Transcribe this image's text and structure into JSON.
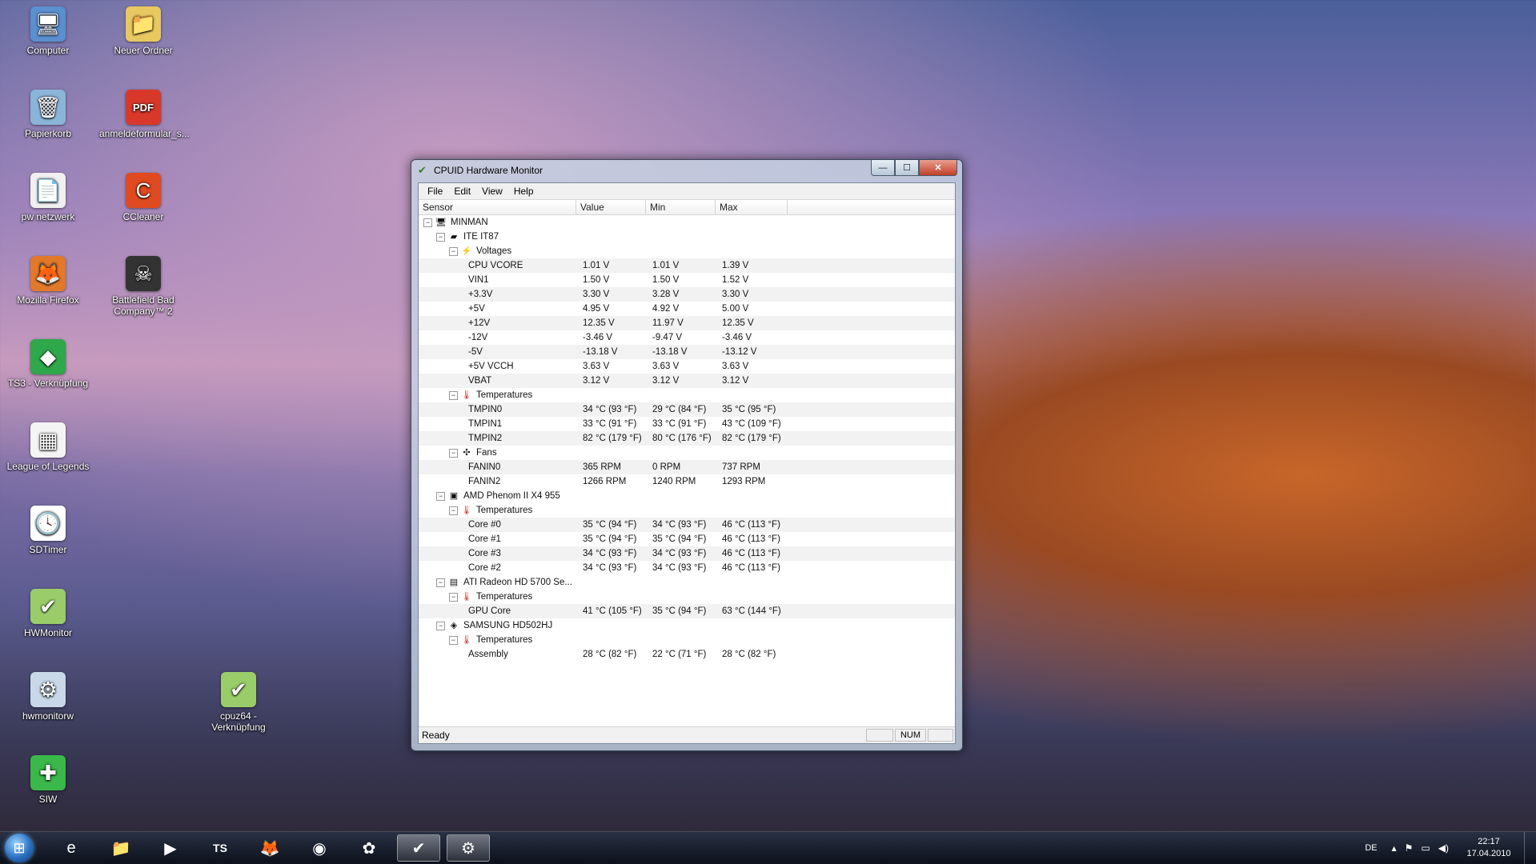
{
  "desktop_icons": [
    {
      "label": "Computer",
      "icon": "computer-icon",
      "glyph": "🖥",
      "bg": "#5a8fd0"
    },
    {
      "label": "Neuer Ordner",
      "icon": "folder-icon",
      "glyph": "📁",
      "bg": "#e8c860"
    },
    {
      "label": "Papierkorb",
      "icon": "recycle-bin-icon",
      "glyph": "🗑",
      "bg": "#8ab4d8"
    },
    {
      "label": "anmeldeformular_s...",
      "icon": "pdf-icon",
      "glyph": "PDF",
      "bg": "#d8382a"
    },
    {
      "label": "pw netzwerk",
      "icon": "text-file-icon",
      "glyph": "📄",
      "bg": "#f0f0f0"
    },
    {
      "label": "CCleaner",
      "icon": "ccleaner-icon",
      "glyph": "C",
      "bg": "#e04a20"
    },
    {
      "label": "Mozilla Firefox",
      "icon": "firefox-icon",
      "glyph": "🦊",
      "bg": "#e2782a"
    },
    {
      "label": "Battlefield Bad Company™ 2",
      "icon": "game-icon",
      "glyph": "☠",
      "bg": "#333333"
    },
    {
      "label": "TS3 - Verknüpfung",
      "icon": "sims-icon",
      "glyph": "◆",
      "bg": "#2ea84a"
    },
    {
      "label": "League of Legends",
      "icon": "calendar-icon",
      "glyph": "▦",
      "bg": "#f4f4f4"
    },
    {
      "label": "SDTimer",
      "icon": "clock-icon",
      "glyph": "🕓",
      "bg": "#ffffff"
    },
    {
      "label": "HWMonitor",
      "icon": "hwmonitor-icon",
      "glyph": "✔",
      "bg": "#9acd6a"
    },
    {
      "label": "hwmonitorw",
      "icon": "gear-icon",
      "glyph": "⚙",
      "bg": "#c8d8e8"
    },
    {
      "label": "cpuz64 - Verknüpfung",
      "icon": "cpuz-icon",
      "glyph": "✔",
      "bg": "#9acd6a"
    },
    {
      "label": "SIW",
      "icon": "siw-icon",
      "glyph": "✚",
      "bg": "#3ab84a"
    }
  ],
  "window": {
    "title": "CPUID Hardware Monitor",
    "buttons": {
      "minimize": "—",
      "maximize": "☐",
      "close": "✕"
    },
    "menu": [
      "File",
      "Edit",
      "View",
      "Help"
    ],
    "columns": [
      "Sensor",
      "Value",
      "Min",
      "Max"
    ],
    "rows": [
      {
        "level": 0,
        "exp": "−",
        "icon": "🖥",
        "name": "MINMAN",
        "value": "",
        "min": "",
        "max": ""
      },
      {
        "level": 1,
        "exp": "−",
        "icon": "▰",
        "name": "ITE IT87",
        "value": "",
        "min": "",
        "max": ""
      },
      {
        "level": 2,
        "exp": "−",
        "icon": "⚡",
        "name": "Voltages",
        "value": "",
        "min": "",
        "max": ""
      },
      {
        "level": 3,
        "exp": "",
        "icon": "",
        "name": "CPU VCORE",
        "value": "1.01 V",
        "min": "1.01 V",
        "max": "1.39 V"
      },
      {
        "level": 3,
        "exp": "",
        "icon": "",
        "name": "VIN1",
        "value": "1.50 V",
        "min": "1.50 V",
        "max": "1.52 V"
      },
      {
        "level": 3,
        "exp": "",
        "icon": "",
        "name": "+3.3V",
        "value": "3.30 V",
        "min": "3.28 V",
        "max": "3.30 V"
      },
      {
        "level": 3,
        "exp": "",
        "icon": "",
        "name": "+5V",
        "value": "4.95 V",
        "min": "4.92 V",
        "max": "5.00 V"
      },
      {
        "level": 3,
        "exp": "",
        "icon": "",
        "name": "+12V",
        "value": "12.35 V",
        "min": "11.97 V",
        "max": "12.35 V"
      },
      {
        "level": 3,
        "exp": "",
        "icon": "",
        "name": "-12V",
        "value": "-3.46 V",
        "min": "-9.47 V",
        "max": "-3.46 V"
      },
      {
        "level": 3,
        "exp": "",
        "icon": "",
        "name": "-5V",
        "value": "-13.18 V",
        "min": "-13.18 V",
        "max": "-13.12 V"
      },
      {
        "level": 3,
        "exp": "",
        "icon": "",
        "name": "+5V VCCH",
        "value": "3.63 V",
        "min": "3.63 V",
        "max": "3.63 V"
      },
      {
        "level": 3,
        "exp": "",
        "icon": "",
        "name": "VBAT",
        "value": "3.12 V",
        "min": "3.12 V",
        "max": "3.12 V"
      },
      {
        "level": 2,
        "exp": "−",
        "icon": "🌡",
        "name": "Temperatures",
        "value": "",
        "min": "",
        "max": ""
      },
      {
        "level": 3,
        "exp": "",
        "icon": "",
        "name": "TMPIN0",
        "value": "34 °C (93 °F)",
        "min": "29 °C (84 °F)",
        "max": "35 °C (95 °F)"
      },
      {
        "level": 3,
        "exp": "",
        "icon": "",
        "name": "TMPIN1",
        "value": "33 °C (91 °F)",
        "min": "33 °C (91 °F)",
        "max": "43 °C (109 °F)"
      },
      {
        "level": 3,
        "exp": "",
        "icon": "",
        "name": "TMPIN2",
        "value": "82 °C (179 °F)",
        "min": "80 °C (176 °F)",
        "max": "82 °C (179 °F)"
      },
      {
        "level": 2,
        "exp": "−",
        "icon": "✣",
        "name": "Fans",
        "value": "",
        "min": "",
        "max": ""
      },
      {
        "level": 3,
        "exp": "",
        "icon": "",
        "name": "FANIN0",
        "value": "365 RPM",
        "min": "0 RPM",
        "max": "737 RPM"
      },
      {
        "level": 3,
        "exp": "",
        "icon": "",
        "name": "FANIN2",
        "value": "1266 RPM",
        "min": "1240 RPM",
        "max": "1293 RPM"
      },
      {
        "level": 1,
        "exp": "−",
        "icon": "▣",
        "name": "AMD Phenom II X4 955",
        "value": "",
        "min": "",
        "max": ""
      },
      {
        "level": 2,
        "exp": "−",
        "icon": "🌡",
        "name": "Temperatures",
        "value": "",
        "min": "",
        "max": ""
      },
      {
        "level": 3,
        "exp": "",
        "icon": "",
        "name": "Core #0",
        "value": "35 °C (94 °F)",
        "min": "34 °C (93 °F)",
        "max": "46 °C (113 °F)"
      },
      {
        "level": 3,
        "exp": "",
        "icon": "",
        "name": "Core #1",
        "value": "35 °C (94 °F)",
        "min": "35 °C (94 °F)",
        "max": "46 °C (113 °F)"
      },
      {
        "level": 3,
        "exp": "",
        "icon": "",
        "name": "Core #3",
        "value": "34 °C (93 °F)",
        "min": "34 °C (93 °F)",
        "max": "46 °C (113 °F)"
      },
      {
        "level": 3,
        "exp": "",
        "icon": "",
        "name": "Core #2",
        "value": "34 °C (93 °F)",
        "min": "34 °C (93 °F)",
        "max": "46 °C (113 °F)"
      },
      {
        "level": 1,
        "exp": "−",
        "icon": "▤",
        "name": "ATI Radeon HD 5700 Se...",
        "value": "",
        "min": "",
        "max": ""
      },
      {
        "level": 2,
        "exp": "−",
        "icon": "🌡",
        "name": "Temperatures",
        "value": "",
        "min": "",
        "max": ""
      },
      {
        "level": 3,
        "exp": "",
        "icon": "",
        "name": "GPU Core",
        "value": "41 °C (105 °F)",
        "min": "35 °C (94 °F)",
        "max": "63 °C (144 °F)"
      },
      {
        "level": 1,
        "exp": "−",
        "icon": "◈",
        "name": "SAMSUNG HD502HJ",
        "value": "",
        "min": "",
        "max": ""
      },
      {
        "level": 2,
        "exp": "−",
        "icon": "🌡",
        "name": "Temperatures",
        "value": "",
        "min": "",
        "max": ""
      },
      {
        "level": 3,
        "exp": "",
        "icon": "",
        "name": "Assembly",
        "value": "28 °C (82 °F)",
        "min": "22 °C (71 °F)",
        "max": "28 °C (82 °F)"
      }
    ],
    "status": {
      "ready": "Ready",
      "num": "NUM"
    }
  },
  "taskbar": {
    "start_icon": "windows-orb-icon",
    "apps": [
      {
        "name": "internet-explorer",
        "glyph": "e",
        "active": false
      },
      {
        "name": "explorer",
        "glyph": "📁",
        "active": false
      },
      {
        "name": "media-player",
        "glyph": "▶",
        "active": false
      },
      {
        "name": "teamspeak",
        "glyph": "TS",
        "active": false
      },
      {
        "name": "firefox",
        "glyph": "🦊",
        "active": false
      },
      {
        "name": "messenger",
        "glyph": "◉",
        "active": false
      },
      {
        "name": "icq",
        "glyph": "✿",
        "active": false
      },
      {
        "name": "hwmonitor",
        "glyph": "✔",
        "active": true
      },
      {
        "name": "cpuz",
        "glyph": "⚙",
        "active": true
      }
    ],
    "tray": {
      "lang": "DE",
      "time": "22:17",
      "date": "17.04.2010"
    }
  }
}
